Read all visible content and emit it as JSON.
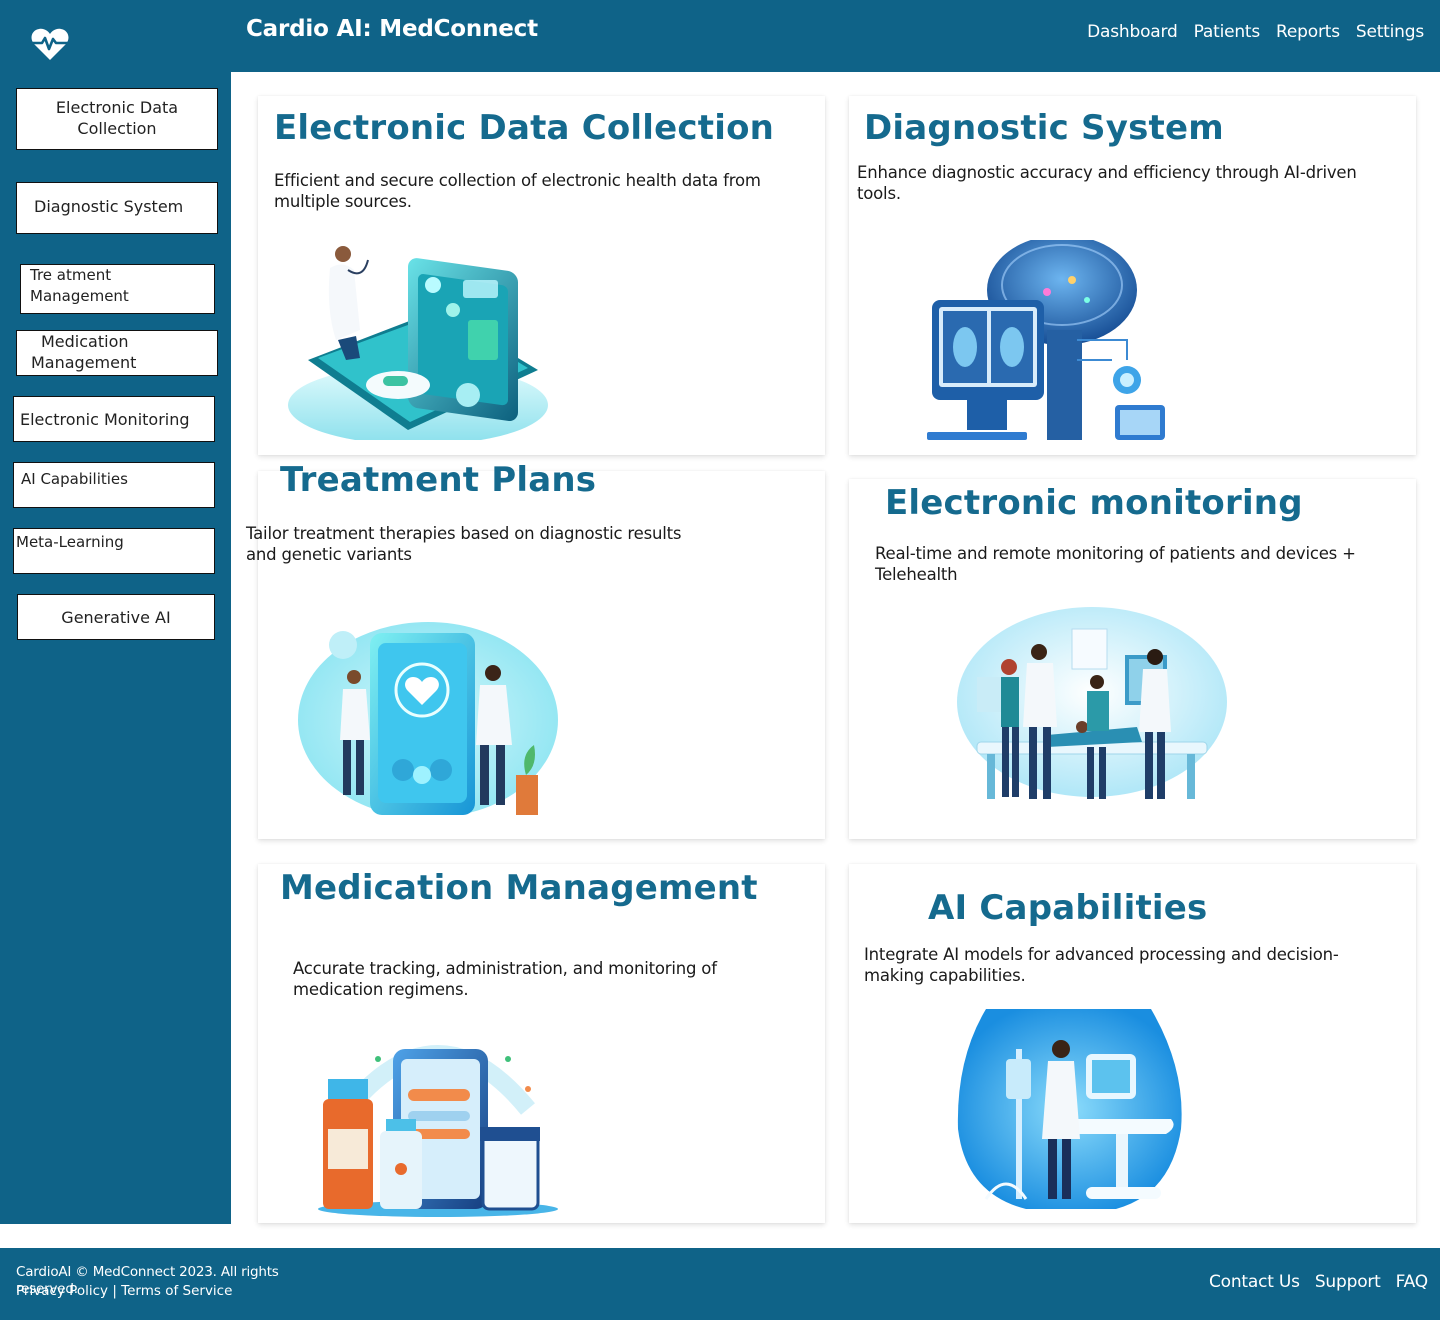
{
  "header": {
    "logo_icon": "heart-pulse-icon",
    "title": "Cardio AI: MedConnect",
    "nav": [
      {
        "label": "Dashboard"
      },
      {
        "label": "Patients"
      },
      {
        "label": "Reports"
      },
      {
        "label": "Settings"
      }
    ]
  },
  "sidebar": {
    "items": [
      {
        "line1": "Electronic Data",
        "line2": "Collection"
      },
      {
        "line1": "Diagnostic System",
        "line2": ""
      },
      {
        "line1": "Tre atment",
        "line2": "Management"
      },
      {
        "line1": "Medication",
        "line2": "Management"
      },
      {
        "line1": "Electronic Monitoring",
        "line2": ""
      },
      {
        "line1": "AI Capabilities",
        "line2": ""
      },
      {
        "line1": "Meta-Learning",
        "line2": ""
      },
      {
        "line1": "Generative AI",
        "line2": ""
      }
    ]
  },
  "cards": [
    {
      "title": "Electronic Data Collection",
      "description": "Efficient and secure collection of electronic health data from multiple sources.",
      "image": "doctor-with-tablet-data-illustration"
    },
    {
      "title": "Diagnostic System",
      "description": "Enhance diagnostic accuracy and efficiency through AI-driven tools.",
      "image": "brain-scan-monitor-illustration"
    },
    {
      "title": "Treatment Plans",
      "description": "Tailor treatment therapies based on diagnostic results and genetic variants",
      "image": "doctors-with-phone-heart-illustration"
    },
    {
      "title": "Electronic monitoring",
      "description": "Real-time and remote monitoring of patients and devices + Telehealth",
      "image": "medical-team-patient-bed-illustration"
    },
    {
      "title": "Medication Management",
      "description": "Accurate tracking, administration, and monitoring of medication regimens.",
      "image": "medicine-bottles-phone-illustration"
    },
    {
      "title": "AI Capabilities",
      "description": "Integrate AI models for advanced processing and decision-making capabilities.",
      "image": "doctor-with-medical-equipment-illustration"
    }
  ],
  "footer": {
    "copyright": "CardioAI © MedConnect 2023. All rights reserved.",
    "privacy": "Privacy Policy",
    "separator": "|",
    "terms": "Terms of Service",
    "nav": [
      {
        "label": "Contact Us"
      },
      {
        "label": "Support"
      },
      {
        "label": "FAQ"
      }
    ]
  },
  "colors": {
    "brand": "#0f6388",
    "heading": "#156a8e",
    "background": "#ffffff"
  }
}
